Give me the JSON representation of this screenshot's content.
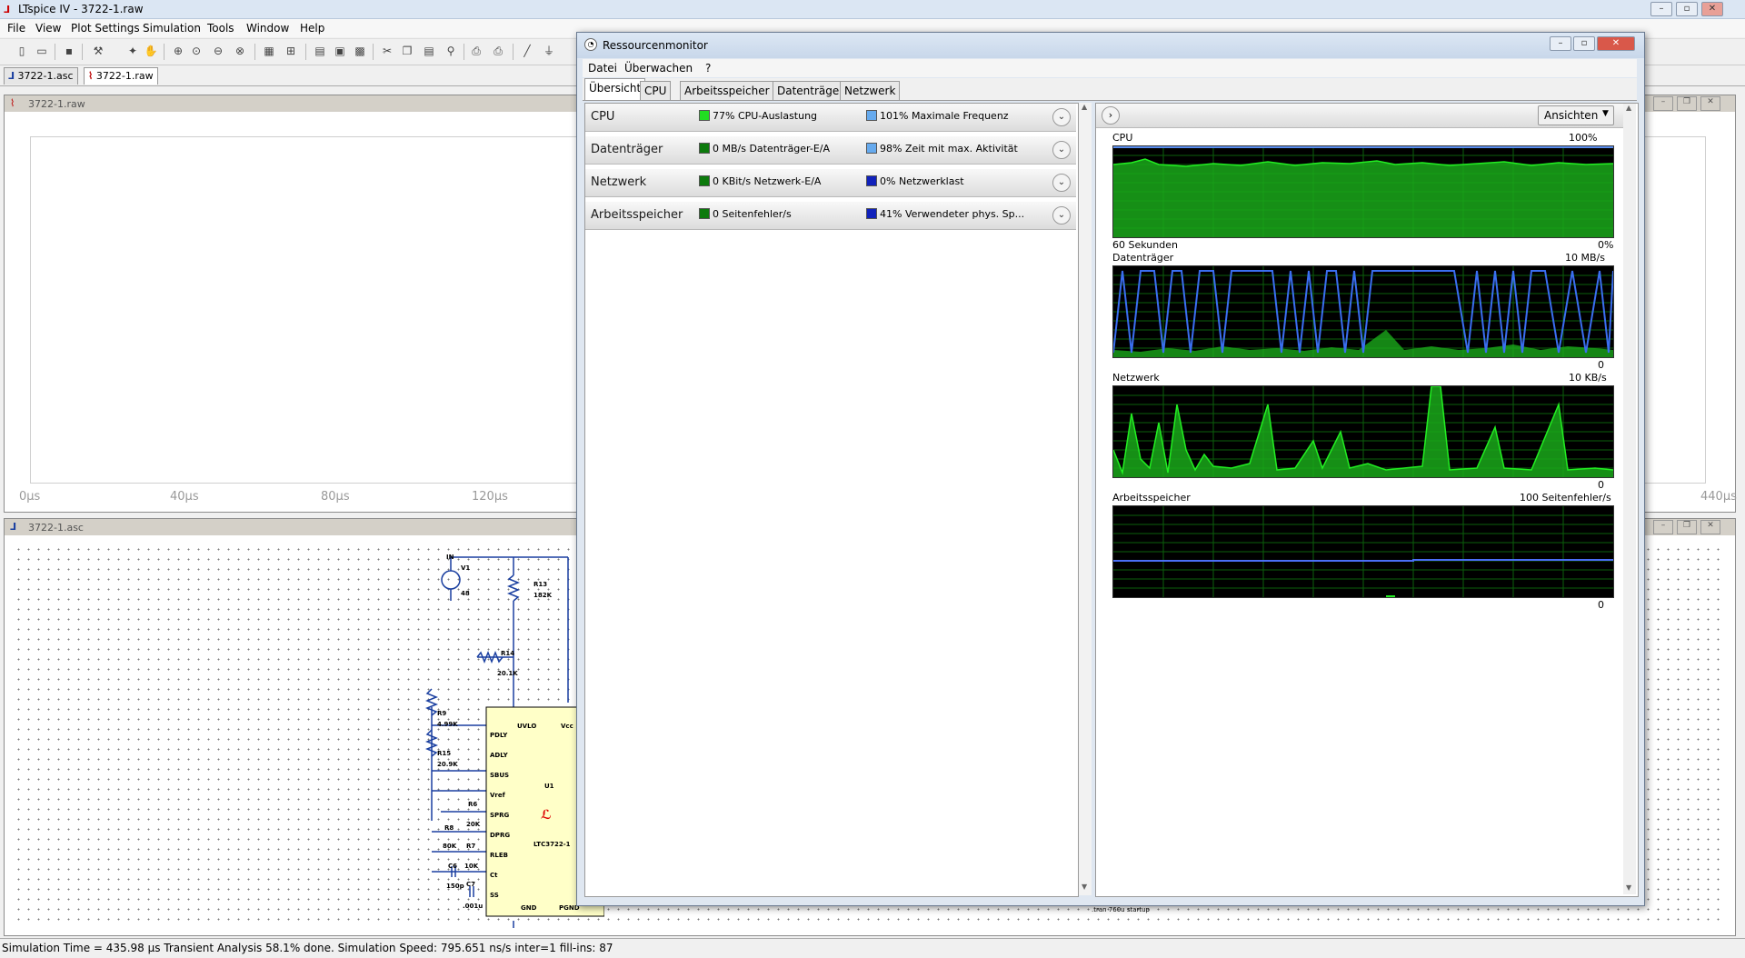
{
  "lt": {
    "title": "LTspice IV - 3722-1.raw",
    "menu": [
      "File",
      "View",
      "Plot Settings",
      "Simulation",
      "Tools",
      "Window",
      "Help"
    ],
    "tabs": [
      "3722-1.asc",
      "3722-1.raw"
    ],
    "plot_pane_title": "3722-1.raw",
    "schematic_pane_title": "3722-1.asc",
    "xticks": [
      "0µs",
      "40µs",
      "80µs",
      "120µs",
      "440µs"
    ],
    "status": "Simulation Time = 435.98 µs  Transient Analysis 58.1% done. Simulation Speed: 795.651 ns/s inter=1 fill-ins: 87",
    "schematic": {
      "in": "IN",
      "v1": "V1",
      "v1_val": "48",
      "r13": "R13",
      "r13_val": "182K",
      "r14": "R14",
      "r14_val": "20.1K",
      "r9": "R9",
      "r9_val": "4.99K",
      "r15": "R15",
      "r15_val": "20.9K",
      "r6": "R6",
      "r6_val": "20K",
      "r8": "R8",
      "r8_val": "80K",
      "r7": "R7",
      "r7_val": "10K",
      "c6": "C6",
      "c6_val": "150p",
      "c7": "C7",
      "c7_val": ".001u",
      "uvlo": "UVLO",
      "vcc": "Vcc",
      "pins": [
        "PDLY",
        "ADLY",
        "SBUS",
        "Vref",
        "SPRG",
        "DPRG",
        "RLEB",
        "Ct",
        "SS"
      ],
      "gnd": "GND",
      "pgnd": "PGND",
      "u1": "U1",
      "part": "LTC3722-1",
      "tran": ".tran 760u startup"
    }
  },
  "rm": {
    "title": "Ressourcenmonitor",
    "menu": [
      "Datei",
      "Überwachen",
      "?"
    ],
    "tabs": [
      "Übersicht",
      "CPU",
      "Arbeitsspeicher",
      "Datenträger",
      "Netzwerk"
    ],
    "sections": [
      {
        "name": "CPU",
        "m1": "77% CPU-Auslastung",
        "m1_color": "#22dd22",
        "m2": "101% Maximale Frequenz",
        "m2_color": "#66aaee"
      },
      {
        "name": "Datenträger",
        "m1": "0 MB/s Datenträger-E/A",
        "m1_color": "#0c7a0c",
        "m2": "98% Zeit mit max. Aktivität",
        "m2_color": "#66aaee"
      },
      {
        "name": "Netzwerk",
        "m1": "0 KBit/s Netzwerk-E/A",
        "m1_color": "#0c7a0c",
        "m2": "0% Netzwerklast",
        "m2_color": "#1122bb"
      },
      {
        "name": "Arbeitsspeicher",
        "m1": "0 Seitenfehler/s",
        "m1_color": "#0c7a0c",
        "m2": "41% Verwendeter phys. Sp...",
        "m2_color": "#1122bb"
      }
    ],
    "view_button": "Ansichten",
    "graphs": [
      {
        "name": "CPU",
        "max": "100%",
        "foot_left": "60 Sekunden",
        "foot_right": "0%"
      },
      {
        "name": "Datenträger",
        "max": "10 MB/s",
        "foot_left": "",
        "foot_right": "0"
      },
      {
        "name": "Netzwerk",
        "max": "10 KB/s",
        "foot_left": "",
        "foot_right": "0"
      },
      {
        "name": "Arbeitsspeicher",
        "max": "100 Seitenfehler/s",
        "foot_left": "",
        "foot_right": "0"
      }
    ]
  }
}
